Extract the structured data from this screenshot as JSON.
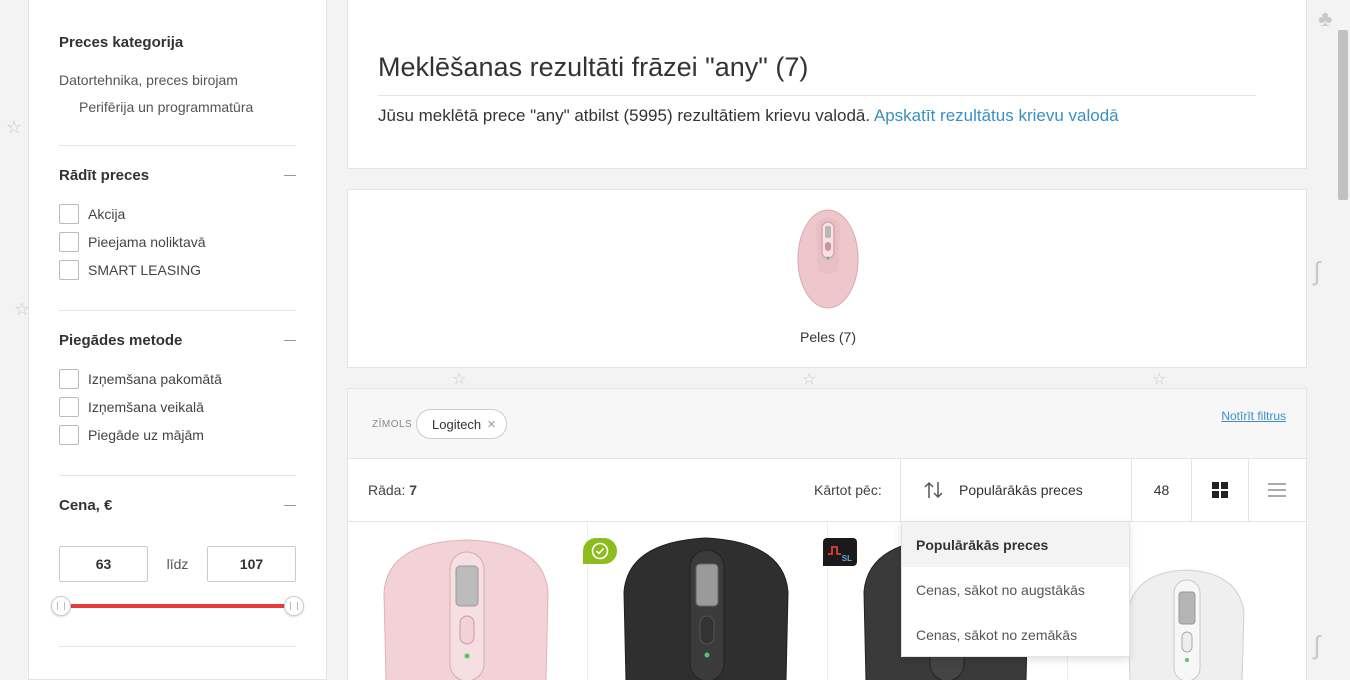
{
  "sidebar": {
    "category_title": "Preces kategorija",
    "categories": [
      "Datortehnika, preces birojam",
      "Perifērija un programmatūra"
    ],
    "show_title": "Rādīt preces",
    "show_options": [
      "Akcija",
      "Pieejama noliktavā",
      "SMART LEASING"
    ],
    "delivery_title": "Piegādes metode",
    "delivery_options": [
      "Izņemšana pakomātā",
      "Izņemšana veikalā",
      "Piegāde uz mājām"
    ],
    "price_title": "Cena, €",
    "price_min": "63",
    "price_to": "līdz",
    "price_max": "107",
    "price_range_fraction": [
      0.0,
      1.0
    ]
  },
  "header": {
    "title": "Meklēšanas rezultāti frāzei \"any\" (7)",
    "subtitle": "Jūsu meklētā prece \"any\" atbilst (5995) rezultātiem krievu valodā.",
    "subtitle_link": "Apskatīt rezultātus krievu valodā"
  },
  "category_card": {
    "label": "Peles (7)",
    "image_icon": "pink-mouse-image"
  },
  "filters": {
    "brand_label": "ZĪMOLS",
    "chip": "Logitech",
    "chip_remove": "×",
    "clear_label": "Notīrīt filtrus"
  },
  "toolbar": {
    "shows_label": "Rāda:",
    "shows_count": "7",
    "sort_label": "Kārtot pēc:",
    "sort_value": "Populārākās preces",
    "per_page": "48"
  },
  "sort_dropdown": {
    "options": [
      "Populārākās preces",
      "Cenas, sākot no augstākās",
      "Cenas, sākot no zemākās"
    ]
  },
  "products": {
    "items": [
      {
        "color": "#f2d2d6",
        "icon": "pink-mouse-image"
      },
      {
        "color": "#2f2f2f",
        "icon": "graphite-mouse-image"
      },
      {
        "color": "#3a3a3a",
        "icon": "black-mouse-image"
      },
      {
        "color": "#efefef",
        "icon": "white-mouse-image"
      }
    ],
    "badge_sl_text": "SL"
  },
  "colors": {
    "accent_link": "#3b8fc4",
    "slider_red": "#e43b3b",
    "badge_green": "#8cbd1f"
  }
}
